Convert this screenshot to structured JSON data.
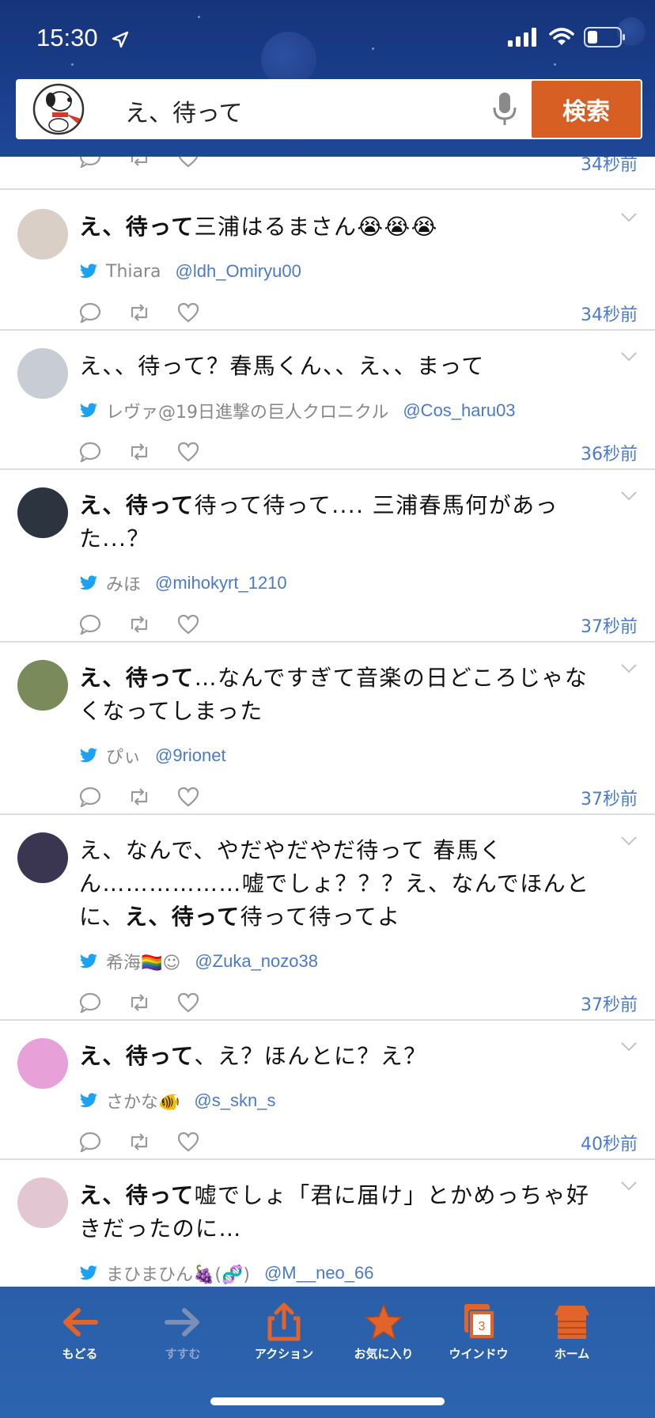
{
  "status_bar": {
    "time": "15:30"
  },
  "search": {
    "query": "え、待って",
    "button_label": "検索"
  },
  "partial_top_row": {
    "time": "34秒前"
  },
  "tweets": [
    {
      "text_bold": "え、待って",
      "text_rest": "三浦はるまさん😭😭😭",
      "name": "Thiara",
      "handle": "@ldh_Omiryu00",
      "time": "34秒前",
      "avatar_color": "#d9cfc6"
    },
    {
      "text_bold": "",
      "text_rest": "え、、待って？春馬くん、、え、、まって",
      "name": "レヴァ@19日進撃の巨人クロニクル",
      "handle": "@Cos_haru03",
      "time": "36秒前",
      "avatar_color": "#c8ccd4"
    },
    {
      "text_bold": "え、待って",
      "text_rest": "待って待って.... 三浦春馬何があった...？",
      "name": "みほ",
      "handle": "@mihokyrt_1210",
      "time": "37秒前",
      "avatar_color": "#2c3440"
    },
    {
      "text_bold": "え、待って",
      "text_rest": "…なんですぎて音楽の日どころじゃなくなってしまった",
      "name": "ぴぃ",
      "handle": "@9rionet",
      "time": "37秒前",
      "avatar_color": "#7a8a5a"
    },
    {
      "text_before": "え、なんで、やだやだやだ待って 春馬くん………………嘘でしょ？？？え、なんでほんとに、",
      "text_bold": "え、待って",
      "text_after": "待って待ってよ",
      "name": "希海🏳️‍🌈☺︎",
      "handle": "@Zuka_nozo38",
      "time": "37秒前",
      "avatar_color": "#3a3550"
    },
    {
      "text_bold": "え、待って",
      "text_rest": "、え？ほんとに？え？",
      "name": "さかな🐠",
      "handle": "@s_skn_s",
      "time": "40秒前",
      "avatar_color": "#e8a0d8"
    },
    {
      "text_bold": "え、待って",
      "text_rest": "嘘でしょ「君に届け」とかめっちゃ好きだったのに…",
      "name": "まひまひん🍇(🧬)",
      "handle": "@M__neo_66",
      "time": "",
      "avatar_color": "#e2c6d2"
    }
  ],
  "toolbar": {
    "back": "もどる",
    "forward": "すすむ",
    "action": "アクション",
    "favorites": "お気に入り",
    "window": "ウインドウ",
    "window_count": "3",
    "home": "ホーム"
  },
  "colors": {
    "accent_orange": "#d75f24",
    "header_blue": "#1b3f8c",
    "link_blue": "#4a7ac9",
    "toolbar_blue": "#2d64b0"
  }
}
